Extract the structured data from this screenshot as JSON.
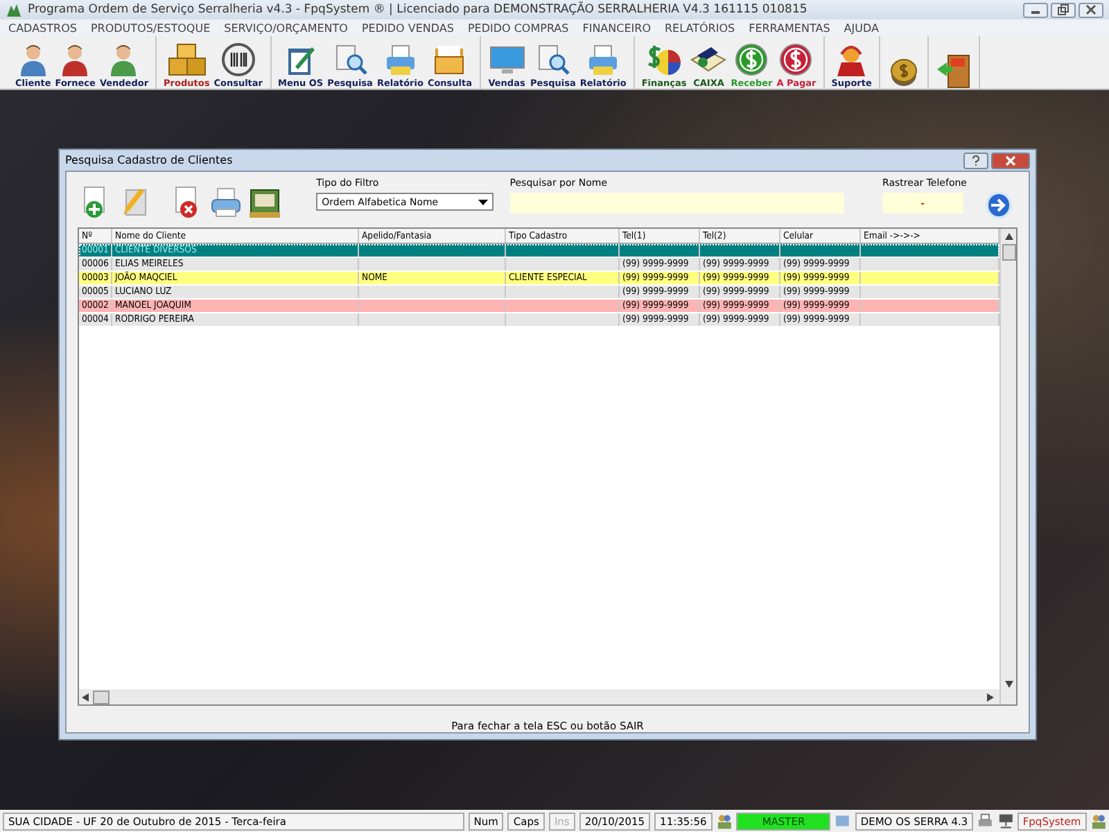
{
  "window": {
    "title": "Programa Ordem de Serviço Serralheria v4.3 - FpqSystem ® | Licenciado para  DEMONSTRAÇÃO SERRALHERIA V4.3 161115 010815"
  },
  "menu": [
    "CADASTROS",
    "PRODUTOS/ESTOQUE",
    "SERVIÇO/ORÇAMENTO",
    "PEDIDO VENDAS",
    "PEDIDO COMPRAS",
    "FINANCEIRO",
    "RELATÓRIOS",
    "FERRAMENTAS",
    "AJUDA"
  ],
  "toolbar": [
    {
      "buttons": [
        {
          "label": "Cliente",
          "kind": "person",
          "color": "#4a7fc0"
        },
        {
          "label": "Fornece",
          "kind": "person",
          "color": "#c0302a"
        },
        {
          "label": "Vendedor",
          "kind": "person",
          "color": "#4a9a4a"
        }
      ]
    },
    {
      "buttons": [
        {
          "label": "Produtos",
          "kind": "boxes"
        },
        {
          "label": "Consultar",
          "kind": "barcode"
        }
      ]
    },
    {
      "buttons": [
        {
          "label": "Menu OS",
          "kind": "clipboard"
        },
        {
          "label": "Pesquisa",
          "kind": "docsearch"
        },
        {
          "label": "Relatório",
          "kind": "printer"
        },
        {
          "label": "Consulta",
          "kind": "folder"
        }
      ]
    },
    {
      "buttons": [
        {
          "label": "Vendas",
          "kind": "monitor"
        },
        {
          "label": "Pesquisa",
          "kind": "docsearch"
        },
        {
          "label": "Relatório",
          "kind": "printer"
        }
      ]
    },
    {
      "buttons": [
        {
          "label": "Finanças",
          "kind": "dollarpie"
        },
        {
          "label": "CAIXA",
          "kind": "book"
        },
        {
          "label": "Receber",
          "kind": "dollar",
          "color": "#2a9a2a"
        },
        {
          "label": "A Pagar",
          "kind": "dollar",
          "color": "#c8203a"
        }
      ]
    },
    {
      "buttons": [
        {
          "label": "Suporte",
          "kind": "support"
        }
      ]
    },
    {
      "buttons": [
        {
          "kind": "coin"
        }
      ]
    },
    {
      "buttons": [
        {
          "kind": "exit"
        }
      ]
    }
  ],
  "dialog": {
    "title": "Pesquisa Cadastro de Clientes",
    "filter": {
      "label": "Tipo do Filtro",
      "value": "Ordem Alfabetica Nome"
    },
    "search": {
      "label": "Pesquisar por Nome"
    },
    "phone": {
      "label": "Rastrear Telefone",
      "value": "-"
    },
    "table": {
      "columns": [
        "Nº",
        "Nome do Cliente",
        "Apelido/Fantasia",
        "Tipo Cadastro",
        "Tel(1)",
        "Tel(2)",
        "Celular",
        "Email ->->->"
      ],
      "rows": [
        {
          "selected": true,
          "color": "#008080",
          "cells": [
            "00001",
            "CLIENTE DIVERSOS",
            "",
            "",
            "",
            "",
            "",
            ""
          ]
        },
        {
          "selected": false,
          "color": "#e6e6e6",
          "cells": [
            "00006",
            "ELIAS MEIRELES",
            "",
            "",
            "(99) 9999-9999",
            "(99) 9999-9999",
            "(99) 9999-9999",
            ""
          ]
        },
        {
          "selected": false,
          "color": "#ffff80",
          "cells": [
            "00003",
            "JOÃO MAQCIEL",
            "NOME",
            "CLIENTE ESPECIAL",
            "(99) 9999-9999",
            "(99) 9999-9999",
            "(99) 9999-9999",
            ""
          ]
        },
        {
          "selected": false,
          "color": "#e6e6e6",
          "cells": [
            "00005",
            "LUCIANO LUZ",
            "",
            "",
            "(99) 9999-9999",
            "(99) 9999-9999",
            "(99) 9999-9999",
            ""
          ]
        },
        {
          "selected": false,
          "color": "#ffb4b4",
          "cells": [
            "00002",
            "MANOEL JOAQUIM",
            "",
            "",
            "(99) 9999-9999",
            "(99) 9999-9999",
            "(99) 9999-9999",
            ""
          ]
        },
        {
          "selected": false,
          "color": "#e6e6e6",
          "cells": [
            "00004",
            "RODRIGO PEREIRA",
            "",
            "",
            "(99) 9999-9999",
            "(99) 9999-9999",
            "(99) 9999-9999",
            ""
          ]
        }
      ]
    },
    "footer": "Para fechar a tela ESC ou botão SAIR"
  },
  "status_bar": {
    "location": "SUA CIDADE - UF 20 de Outubro de 2015 - Terca-feira",
    "keys": [
      {
        "label": "Num",
        "disabled": false
      },
      {
        "label": "Caps",
        "disabled": false
      },
      {
        "label": "Ins",
        "disabled": true
      }
    ],
    "date": "20/10/2015",
    "time": "11:35:56",
    "user": "MASTER",
    "database": "DEMO OS SERRA 4.3",
    "brand": "FpqSystem"
  }
}
